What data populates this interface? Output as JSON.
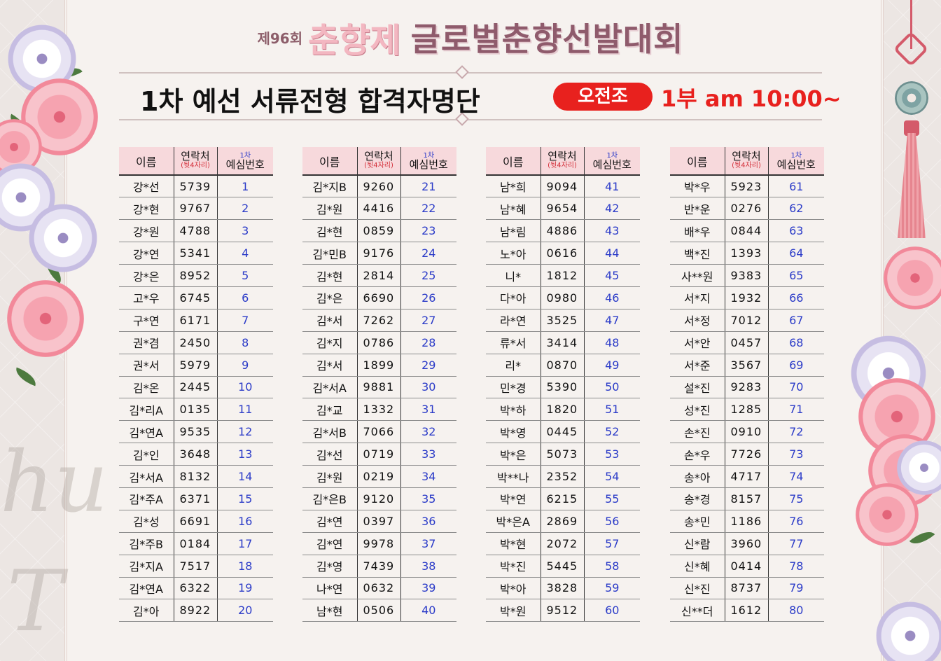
{
  "header": {
    "edition": "제96회",
    "festival": "춘향제",
    "title": "글로벌춘향선발대회",
    "subtitle": "1차 예선 서류전형 합격자명단",
    "badge": "오전조",
    "session": "1부 am 10:00~"
  },
  "columns": {
    "name": "이름",
    "phone": "연락처",
    "phone_note": "(뒷4자리)",
    "num_top": "1차",
    "num": "예심번호"
  },
  "colors": {
    "badge_red": "#e8211e",
    "number_blue": "#2b3bc8",
    "header_pink": "#f7d9dc"
  },
  "tables": [
    {
      "rows": [
        {
          "name": "강*선",
          "phone": "5739",
          "num": "1"
        },
        {
          "name": "강*현",
          "phone": "9767",
          "num": "2"
        },
        {
          "name": "강*원",
          "phone": "4788",
          "num": "3"
        },
        {
          "name": "강*연",
          "phone": "5341",
          "num": "4"
        },
        {
          "name": "강*은",
          "phone": "8952",
          "num": "5"
        },
        {
          "name": "고*우",
          "phone": "6745",
          "num": "6"
        },
        {
          "name": "구*연",
          "phone": "6171",
          "num": "7"
        },
        {
          "name": "권*겸",
          "phone": "2450",
          "num": "8"
        },
        {
          "name": "권*서",
          "phone": "5979",
          "num": "9"
        },
        {
          "name": "김*온",
          "phone": "2445",
          "num": "10"
        },
        {
          "name": "김*리A",
          "phone": "0135",
          "num": "11"
        },
        {
          "name": "김*연A",
          "phone": "9535",
          "num": "12"
        },
        {
          "name": "김*인",
          "phone": "3648",
          "num": "13"
        },
        {
          "name": "김*서A",
          "phone": "8132",
          "num": "14"
        },
        {
          "name": "김*주A",
          "phone": "6371",
          "num": "15"
        },
        {
          "name": "김*성",
          "phone": "6691",
          "num": "16"
        },
        {
          "name": "김*주B",
          "phone": "0184",
          "num": "17"
        },
        {
          "name": "김*지A",
          "phone": "7517",
          "num": "18"
        },
        {
          "name": "김*연A",
          "phone": "6322",
          "num": "19"
        },
        {
          "name": "김*아",
          "phone": "8922",
          "num": "20"
        }
      ]
    },
    {
      "rows": [
        {
          "name": "김*지B",
          "phone": "9260",
          "num": "21"
        },
        {
          "name": "김*원",
          "phone": "4416",
          "num": "22"
        },
        {
          "name": "김*현",
          "phone": "0859",
          "num": "23"
        },
        {
          "name": "김*민B",
          "phone": "9176",
          "num": "24"
        },
        {
          "name": "김*현",
          "phone": "2814",
          "num": "25"
        },
        {
          "name": "김*은",
          "phone": "6690",
          "num": "26"
        },
        {
          "name": "김*서",
          "phone": "7262",
          "num": "27"
        },
        {
          "name": "김*지",
          "phone": "0786",
          "num": "28"
        },
        {
          "name": "김*서",
          "phone": "1899",
          "num": "29"
        },
        {
          "name": "김*서A",
          "phone": "9881",
          "num": "30"
        },
        {
          "name": "김*교",
          "phone": "1332",
          "num": "31"
        },
        {
          "name": "김*서B",
          "phone": "7066",
          "num": "32"
        },
        {
          "name": "김*선",
          "phone": "0719",
          "num": "33"
        },
        {
          "name": "김*원",
          "phone": "0219",
          "num": "34"
        },
        {
          "name": "김*은B",
          "phone": "9120",
          "num": "35"
        },
        {
          "name": "김*연",
          "phone": "0397",
          "num": "36"
        },
        {
          "name": "김*연",
          "phone": "9978",
          "num": "37"
        },
        {
          "name": "김*영",
          "phone": "7439",
          "num": "38"
        },
        {
          "name": "나*연",
          "phone": "0632",
          "num": "39"
        },
        {
          "name": "남*현",
          "phone": "0506",
          "num": "40"
        }
      ]
    },
    {
      "rows": [
        {
          "name": "남*희",
          "phone": "9094",
          "num": "41"
        },
        {
          "name": "남*혜",
          "phone": "9654",
          "num": "42"
        },
        {
          "name": "남*림",
          "phone": "4886",
          "num": "43"
        },
        {
          "name": "노*아",
          "phone": "0616",
          "num": "44"
        },
        {
          "name": "니*",
          "phone": "1812",
          "num": "45"
        },
        {
          "name": "다*아",
          "phone": "0980",
          "num": "46"
        },
        {
          "name": "라*연",
          "phone": "3525",
          "num": "47"
        },
        {
          "name": "류*서",
          "phone": "3414",
          "num": "48"
        },
        {
          "name": "리*",
          "phone": "0870",
          "num": "49"
        },
        {
          "name": "민*경",
          "phone": "5390",
          "num": "50"
        },
        {
          "name": "박*하",
          "phone": "1820",
          "num": "51"
        },
        {
          "name": "박*영",
          "phone": "0445",
          "num": "52"
        },
        {
          "name": "박*은",
          "phone": "5073",
          "num": "53"
        },
        {
          "name": "박**나",
          "phone": "2352",
          "num": "54"
        },
        {
          "name": "박*연",
          "phone": "6215",
          "num": "55"
        },
        {
          "name": "박*은A",
          "phone": "2869",
          "num": "56"
        },
        {
          "name": "박*현",
          "phone": "2072",
          "num": "57"
        },
        {
          "name": "박*진",
          "phone": "5445",
          "num": "58"
        },
        {
          "name": "박*아",
          "phone": "3828",
          "num": "59"
        },
        {
          "name": "박*원",
          "phone": "9512",
          "num": "60"
        }
      ]
    },
    {
      "rows": [
        {
          "name": "박*우",
          "phone": "5923",
          "num": "61"
        },
        {
          "name": "반*운",
          "phone": "0276",
          "num": "62"
        },
        {
          "name": "배*우",
          "phone": "0844",
          "num": "63"
        },
        {
          "name": "백*진",
          "phone": "1393",
          "num": "64"
        },
        {
          "name": "사**원",
          "phone": "9383",
          "num": "65"
        },
        {
          "name": "서*지",
          "phone": "1932",
          "num": "66"
        },
        {
          "name": "서*정",
          "phone": "7012",
          "num": "67"
        },
        {
          "name": "서*안",
          "phone": "0457",
          "num": "68"
        },
        {
          "name": "서*준",
          "phone": "3567",
          "num": "69"
        },
        {
          "name": "설*진",
          "phone": "9283",
          "num": "70"
        },
        {
          "name": "성*진",
          "phone": "1285",
          "num": "71"
        },
        {
          "name": "손*진",
          "phone": "0910",
          "num": "72"
        },
        {
          "name": "손*우",
          "phone": "7726",
          "num": "73"
        },
        {
          "name": "송*아",
          "phone": "4717",
          "num": "74"
        },
        {
          "name": "송*경",
          "phone": "8157",
          "num": "75"
        },
        {
          "name": "송*민",
          "phone": "1186",
          "num": "76"
        },
        {
          "name": "신*람",
          "phone": "3960",
          "num": "77"
        },
        {
          "name": "신*혜",
          "phone": "0414",
          "num": "78"
        },
        {
          "name": "신*진",
          "phone": "8737",
          "num": "79"
        },
        {
          "name": "신**더",
          "phone": "1612",
          "num": "80"
        }
      ]
    }
  ]
}
